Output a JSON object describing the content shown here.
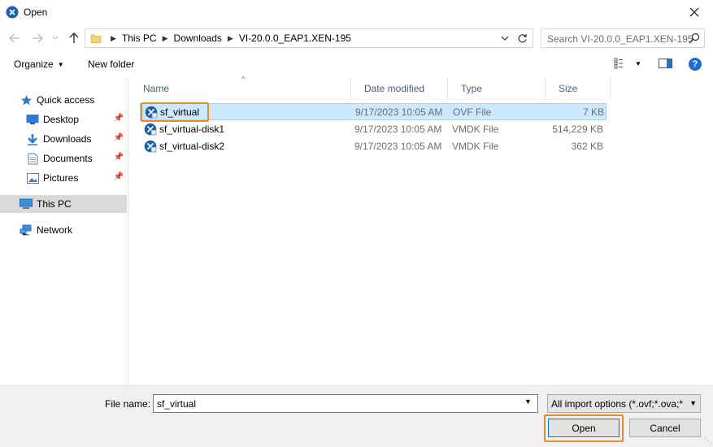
{
  "window": {
    "title": "Open"
  },
  "address": {
    "crumbs": [
      "This PC",
      "Downloads",
      "VI-20.0.0_EAP1.XEN-195"
    ]
  },
  "search": {
    "placeholder": "Search VI-20.0.0_EAP1.XEN-195"
  },
  "toolbar": {
    "organize_label": "Organize",
    "new_folder_label": "New folder"
  },
  "nav": {
    "quick_access": "Quick access",
    "items": [
      {
        "label": "Desktop",
        "icon": "desktop-icon"
      },
      {
        "label": "Downloads",
        "icon": "downloads-icon"
      },
      {
        "label": "Documents",
        "icon": "documents-icon"
      },
      {
        "label": "Pictures",
        "icon": "pictures-icon"
      }
    ],
    "this_pc": "This PC",
    "network": "Network"
  },
  "columns": {
    "name": "Name",
    "date": "Date modified",
    "type": "Type",
    "size": "Size"
  },
  "files": [
    {
      "name": "sf_virtual",
      "date": "9/17/2023 10:05 AM",
      "type": "OVF File",
      "size": "7 KB",
      "selected": true
    },
    {
      "name": "sf_virtual-disk1",
      "date": "9/17/2023 10:05 AM",
      "type": "VMDK File",
      "size": "514,229 KB",
      "selected": false
    },
    {
      "name": "sf_virtual-disk2",
      "date": "9/17/2023 10:05 AM",
      "type": "VMDK File",
      "size": "362 KB",
      "selected": false
    }
  ],
  "footer": {
    "file_name_label": "File name:",
    "file_name_value": "sf_virtual",
    "filter_value": "All import options (*.ovf;*.ova;*",
    "open_label": "Open",
    "cancel_label": "Cancel"
  },
  "colors": {
    "accent": "#0078d7",
    "selection": "#cce8ff",
    "highlight": "#e98a2d"
  }
}
